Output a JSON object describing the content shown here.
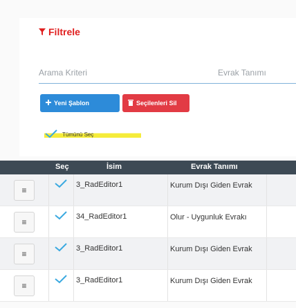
{
  "filters": {
    "title": "Filtrele",
    "search_placeholder": "Arama Kriteri",
    "doc_type_placeholder": "Evrak Tanımı",
    "new_template_label": "Yeni Şablon",
    "delete_selected_label": "Seçilenleri Sil",
    "select_all_label": "Tümünü Seç"
  },
  "table": {
    "columns": [
      "Seç",
      "İsim",
      "Evrak Tanımı"
    ],
    "rows": [
      {
        "name": "3_RadEditor1",
        "type": "Kurum Dışı Giden Evrak"
      },
      {
        "name": "34_RadEditor1",
        "type": "Olur - Uygunluk Evrakı"
      },
      {
        "name": "3_RadEditor1",
        "type": "Kurum Dışı Giden Evrak"
      },
      {
        "name": "3_RadEditor1",
        "type": "Kurum Dışı Giden Evrak"
      }
    ]
  },
  "colors": {
    "accent_red": "#e02020",
    "primary_blue": "#2d8bd9",
    "danger_red": "#e23b44",
    "header_dark": "#3d4a55",
    "check_teal": "#3aa9e0",
    "highlight_yellow": "#f5ec3a"
  },
  "icons": {
    "filter": "filter-icon",
    "plus": "plus-icon",
    "trash": "trash-icon",
    "check": "check-icon",
    "menu": "menu-icon"
  }
}
